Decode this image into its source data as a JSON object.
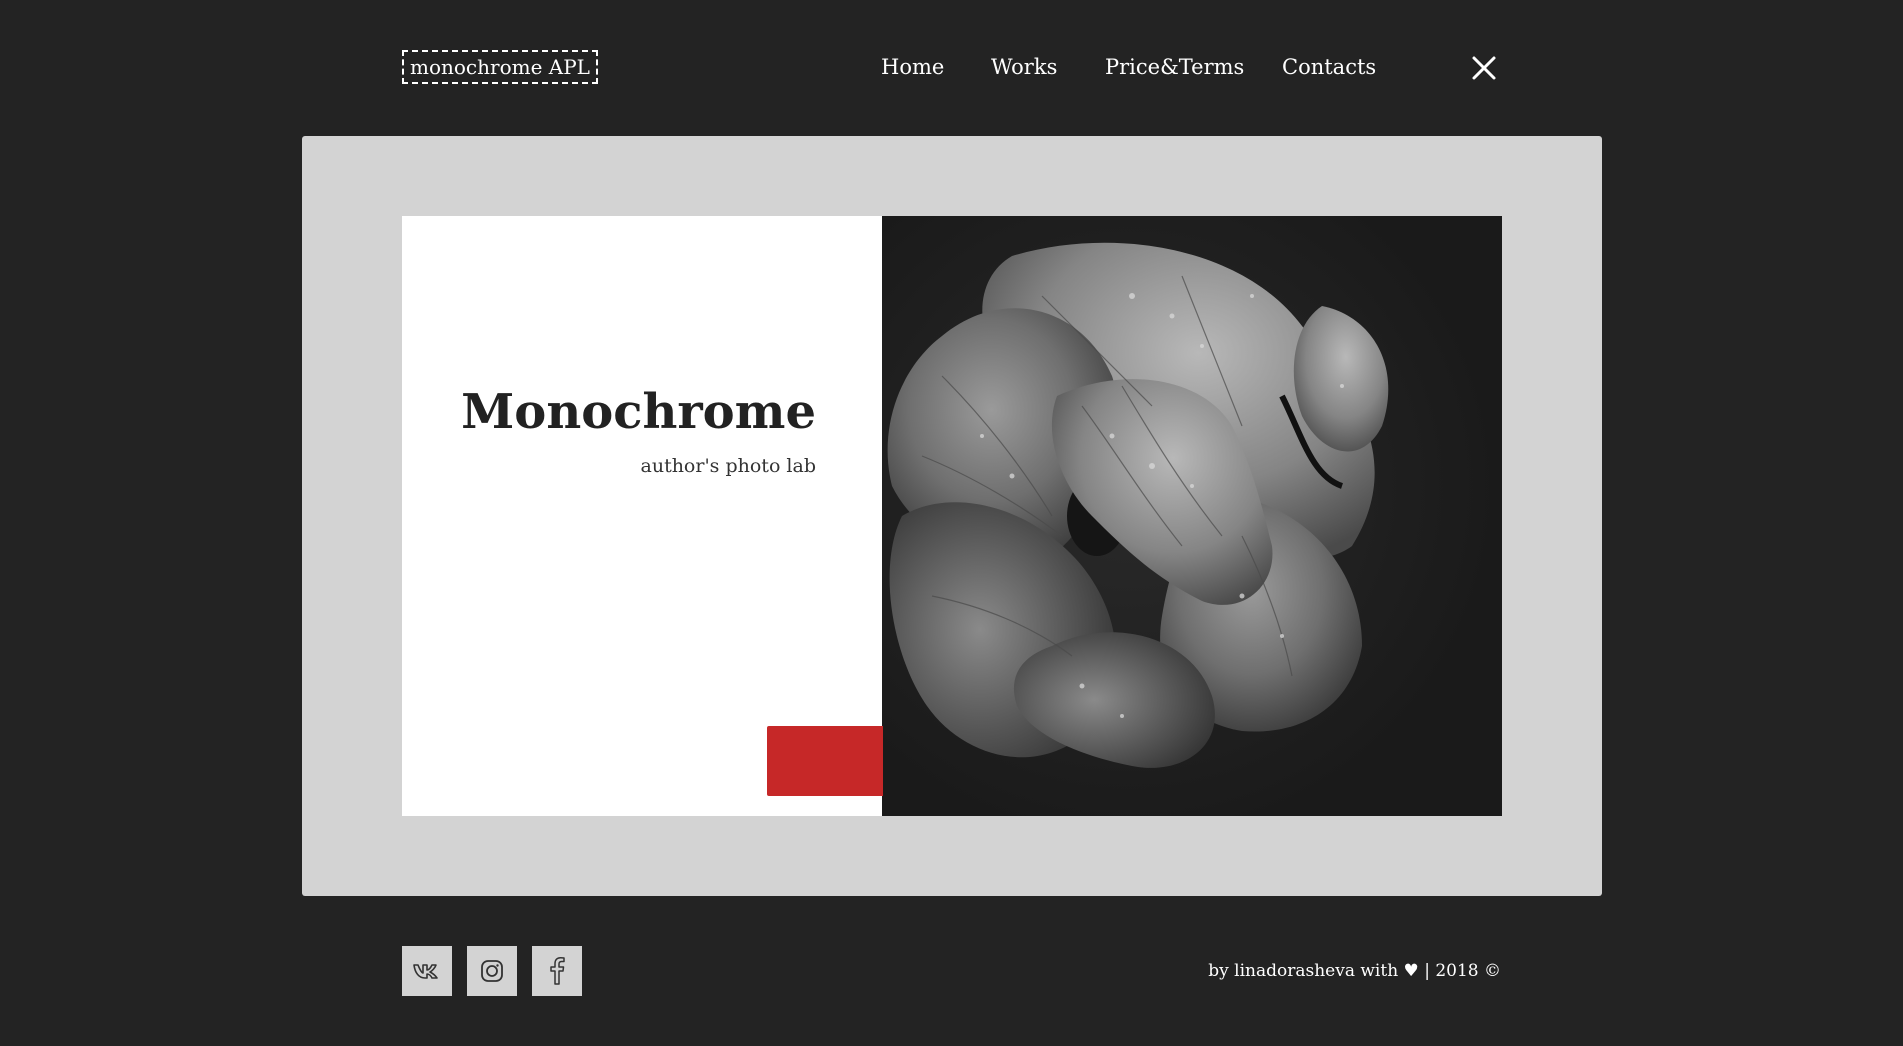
{
  "header": {
    "logo": "monochrome APL",
    "nav": [
      {
        "label": "Home"
      },
      {
        "label": "Works"
      },
      {
        "label": "Price&Terms"
      },
      {
        "label": "Contacts"
      }
    ],
    "close_icon": "close-icon"
  },
  "hero": {
    "title": "Monochrome",
    "subtitle": "author's photo lab",
    "accent_color": "#c62828",
    "photo_icon": "poppy-flower-photo"
  },
  "footer": {
    "social": [
      {
        "icon": "vk-icon"
      },
      {
        "icon": "instagram-icon"
      },
      {
        "icon": "facebook-icon"
      }
    ],
    "credit": "by linadorasheva with ♥ | 2018 ©"
  },
  "colors": {
    "background": "#232323",
    "frame": "#d3d3d3",
    "card": "#ffffff",
    "text_light": "#ffffff",
    "text_dark": "#222222"
  }
}
